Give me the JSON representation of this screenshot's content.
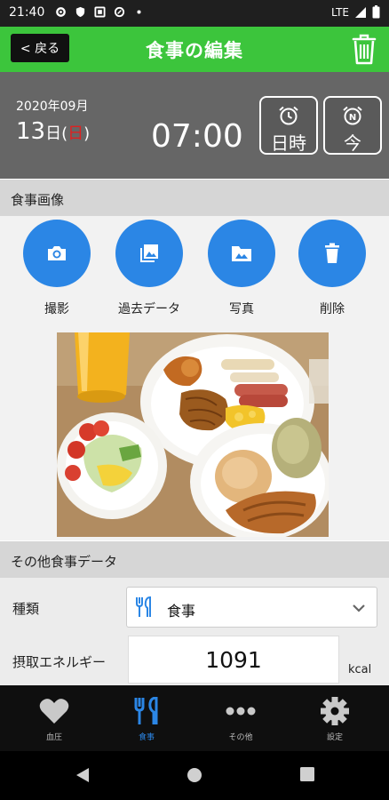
{
  "status_bar": {
    "time": "21:40",
    "network": "LTE"
  },
  "header": {
    "back_label": "< 戻る",
    "title": "食事の編集"
  },
  "date_bar": {
    "year_month": "2020年09月",
    "day": "13",
    "day_unit": "日",
    "weekday_open": "(",
    "weekday": "日",
    "weekday_close": ")",
    "time": "07:00",
    "datetime_button": "日時",
    "now_button": "今",
    "now_icon_letter": "N"
  },
  "image_section": {
    "header": "食事画像",
    "buttons": [
      {
        "label": "撮影",
        "icon": "camera-icon"
      },
      {
        "label": "過去データ",
        "icon": "gallery-icon"
      },
      {
        "label": "写真",
        "icon": "photo-folder-icon"
      },
      {
        "label": "削除",
        "icon": "trash-icon"
      }
    ]
  },
  "other_section": {
    "header": "その他食事データ",
    "type_label": "種類",
    "type_value": "食事",
    "energy_label": "摂取エネルギー",
    "energy_value": "1091",
    "energy_unit": "kcal"
  },
  "tabs": [
    {
      "label": "血圧",
      "icon": "heart-icon"
    },
    {
      "label": "食事",
      "icon": "fork-knife-icon",
      "active": true
    },
    {
      "label": "その他",
      "icon": "more-icon"
    },
    {
      "label": "設定",
      "icon": "gear-icon"
    }
  ],
  "colors": {
    "accent_green": "#3cc53c",
    "accent_blue": "#2b86e5",
    "date_bar_gray": "#666666",
    "sunday_red": "#e02020"
  }
}
